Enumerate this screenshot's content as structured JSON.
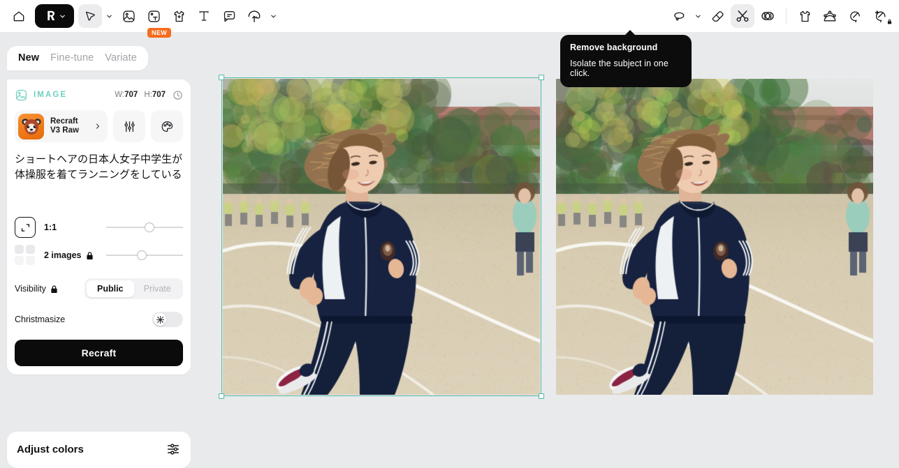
{
  "toolbar": {
    "left_items": [
      {
        "name": "home-icon",
        "label": "Home"
      },
      {
        "name": "logo-pill",
        "label": "Recraft"
      },
      {
        "name": "select-tool",
        "label": "Select"
      },
      {
        "name": "image-tool",
        "label": "Image"
      },
      {
        "name": "text-image-tool",
        "label": "Text to image"
      },
      {
        "name": "mockup-tool",
        "label": "Mockup"
      },
      {
        "name": "text-tool",
        "label": "Text"
      },
      {
        "name": "comment-tool",
        "label": "Comment"
      },
      {
        "name": "upload-tool",
        "label": "Upload"
      }
    ],
    "new_badge": "NEW",
    "right_items": [
      {
        "name": "lasso-tool",
        "label": "Lasso"
      },
      {
        "name": "eraser-tool",
        "label": "Eraser"
      },
      {
        "name": "remove-background-tool",
        "label": "Remove background"
      },
      {
        "name": "inpaint-tool",
        "label": "Inpaint"
      },
      {
        "name": "apparel-tool",
        "label": "Apparel"
      },
      {
        "name": "upscale-tool",
        "label": "Upscale"
      },
      {
        "name": "vectorize-tool",
        "label": "Vectorize"
      },
      {
        "name": "enhance-tool",
        "label": "Enhance"
      }
    ]
  },
  "tooltip": {
    "title": "Remove background",
    "subtitle": "Isolate the subject in one click."
  },
  "panel": {
    "tabs": [
      {
        "label": "New",
        "selected": true
      },
      {
        "label": "Fine-tune",
        "selected": false
      },
      {
        "label": "Variate",
        "selected": false
      }
    ],
    "section_label": "IMAGE",
    "section_color": "#6fd0c0",
    "width_key": "W:",
    "width_value": "707",
    "height_key": "H:",
    "height_value": "707",
    "model": {
      "line1": "Recraft",
      "line2": "V3 Raw"
    },
    "prompt": "ショートヘアの日本人女子中学生が体操服を着てランニングをしている",
    "aspect_ratio": {
      "label": "1:1",
      "slider_percent": 62
    },
    "image_count": {
      "label": "2 images",
      "locked": true,
      "slider_percent": 51
    },
    "visibility": {
      "label": "Visibility",
      "locked": true,
      "options": [
        "Public",
        "Private"
      ],
      "selected": "Public"
    },
    "christmasize": {
      "label": "Christmasize",
      "enabled": false
    },
    "generate_button": "Recraft",
    "adjust_colors": "Adjust colors"
  },
  "canvas": {
    "selection_color": "#4fb9a6",
    "images": [
      {
        "name": "generated-image-1",
        "alt": "Japanese schoolgirl with short hair running in a track suit",
        "selected": true
      },
      {
        "name": "generated-image-2",
        "alt": "Japanese schoolgirl with short hair running in a track suit",
        "selected": false
      }
    ]
  }
}
